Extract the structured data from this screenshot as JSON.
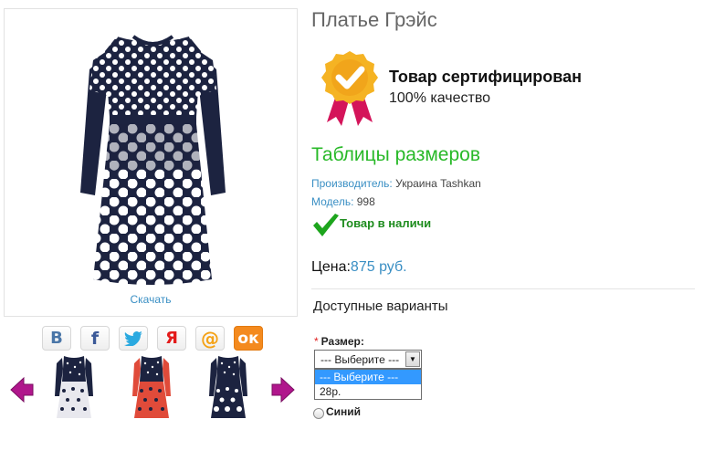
{
  "product": {
    "title": "Платье Грэйс",
    "download_label": "Скачать"
  },
  "social": [
    {
      "name": "vk",
      "glyph": "В"
    },
    {
      "name": "facebook",
      "glyph": "f"
    },
    {
      "name": "twitter",
      "glyph": "🐦"
    },
    {
      "name": "yandex",
      "glyph": "Я"
    },
    {
      "name": "mail",
      "glyph": "@"
    },
    {
      "name": "odnoklassniki",
      "glyph": "ок"
    }
  ],
  "certificate": {
    "title": "Товар сертифицирован",
    "subtitle": "100% качество"
  },
  "size_table_link": "Таблицы размеров",
  "meta": {
    "manufacturer_key": "Производитель:",
    "manufacturer_value": "Украина Tashkan",
    "model_key": "Модель:",
    "model_value": "998"
  },
  "stock_text": "Товар в наличи",
  "price": {
    "label": "Цена:",
    "value": "875 руб."
  },
  "variants": {
    "heading": "Доступные варианты",
    "size_label": "Размер:",
    "required_mark": "*",
    "selected": "--- Выберите ---",
    "options": [
      "--- Выберите ---",
      "28р."
    ],
    "color_option": "Синий"
  },
  "colors": {
    "link": "#3a8fc4",
    "green": "#28b928",
    "badge_gold": "#f5b323",
    "ribbon": "#d4145a",
    "arrow": "#b0168c"
  }
}
